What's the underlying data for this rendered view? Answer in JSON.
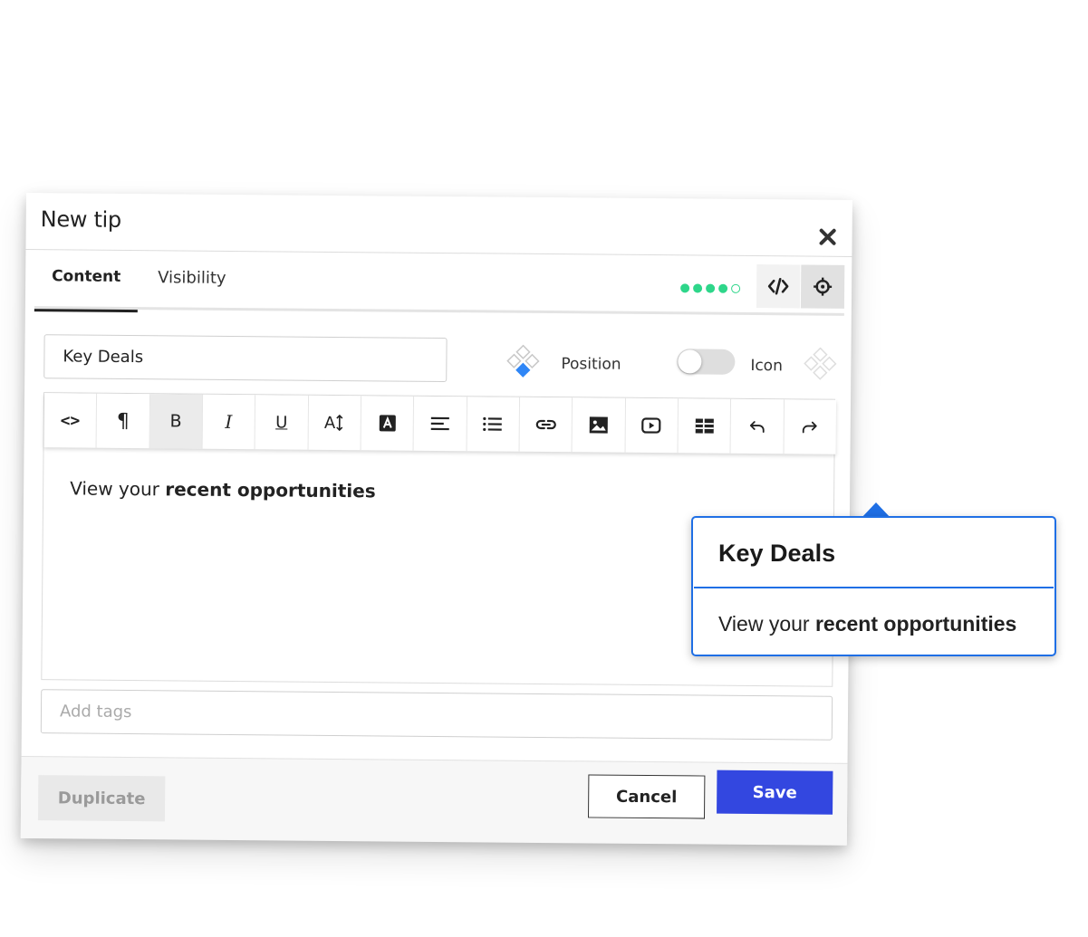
{
  "dialog": {
    "title": "New tip",
    "tabs": [
      {
        "label": "Content",
        "active": true
      },
      {
        "label": "Visibility",
        "active": false
      }
    ],
    "progress_dots": {
      "filled": 4,
      "total": 5,
      "color": "#2ed68a"
    }
  },
  "form": {
    "tip_name": "Key Deals",
    "position_label": "Position",
    "icon_label": "Icon",
    "icon_enabled": false,
    "tags_placeholder": "Add tags"
  },
  "toolbar": {
    "items": [
      {
        "name": "code-view",
        "icon": "code-brackets-icon"
      },
      {
        "name": "paragraph",
        "icon": "pilcrow-icon"
      },
      {
        "name": "bold",
        "icon": "bold-icon",
        "active": true
      },
      {
        "name": "italic",
        "icon": "italic-icon"
      },
      {
        "name": "underline",
        "icon": "underline-icon"
      },
      {
        "name": "font-size",
        "icon": "font-size-icon"
      },
      {
        "name": "text-color",
        "icon": "text-color-icon"
      },
      {
        "name": "align",
        "icon": "align-left-icon"
      },
      {
        "name": "list",
        "icon": "bullet-list-icon"
      },
      {
        "name": "link",
        "icon": "link-icon"
      },
      {
        "name": "image",
        "icon": "image-icon"
      },
      {
        "name": "video",
        "icon": "video-icon"
      },
      {
        "name": "table",
        "icon": "table-icon"
      },
      {
        "name": "undo",
        "icon": "undo-icon"
      },
      {
        "name": "redo",
        "icon": "redo-icon"
      }
    ],
    "glyphs": {
      "code": "<>",
      "paragraph": "¶",
      "bold": "B",
      "italic": "I",
      "underline": "U",
      "font_size": "A"
    }
  },
  "editor": {
    "text_prefix": "View your ",
    "text_bold": "recent opportunities"
  },
  "footer": {
    "duplicate_label": "Duplicate",
    "cancel_label": "Cancel",
    "save_label": "Save"
  },
  "preview": {
    "title": "Key Deals",
    "body_prefix": "View your ",
    "body_bold": "recent opportunities",
    "accent_color": "#1f6fe5"
  },
  "colors": {
    "primary": "#3347e0",
    "accent_blue": "#1f6fe5",
    "success": "#2ed68a"
  }
}
